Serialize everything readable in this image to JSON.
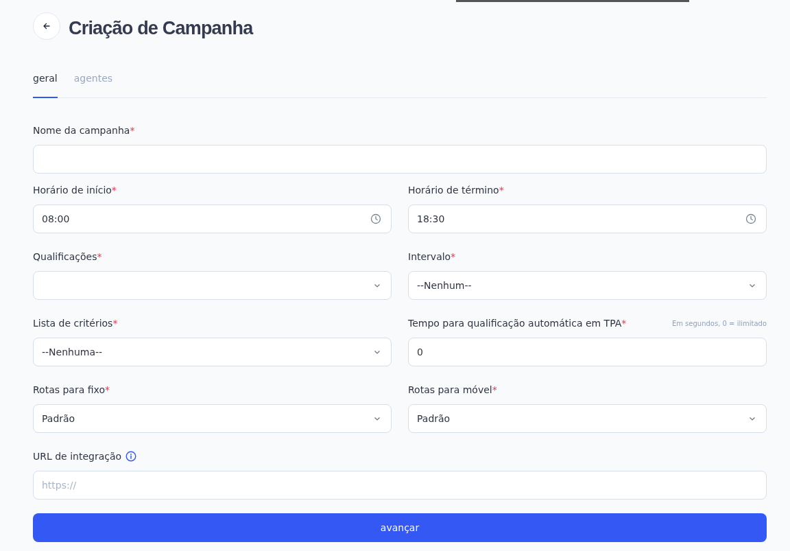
{
  "title": "Criação de Campanha",
  "tabs": [
    {
      "label": "geral",
      "selected": true
    },
    {
      "label": "agentes",
      "selected": false
    }
  ],
  "rows": [
    {
      "fields": [
        {
          "kind": "text",
          "label": "Nome da campanha",
          "required_mark": "*"
        }
      ]
    },
    {
      "fields": [
        {
          "kind": "time",
          "label": "Horário de início",
          "required_mark": "*",
          "value": "08:00"
        },
        {
          "kind": "time",
          "label": "Horário de término",
          "required_mark": "*",
          "value": "18:30"
        }
      ]
    },
    {
      "fields": [
        {
          "kind": "select",
          "label": "Qualificações",
          "required_mark": "*"
        },
        {
          "kind": "select",
          "label": "Intervalo",
          "required_mark": "*",
          "value": "--Nenhum--"
        }
      ]
    },
    {
      "fields": [
        {
          "kind": "select",
          "label": "Lista de critérios",
          "required_mark": "*",
          "value": "--Nenhuma--"
        },
        {
          "kind": "text",
          "label": "Tempo para qualificação automática em TPA",
          "required_mark": "*",
          "hint": "Em segundos, 0 = ilimitado",
          "value": "0"
        }
      ]
    },
    {
      "fields": [
        {
          "kind": "select",
          "label": "Rotas para fixo",
          "required_mark": "*",
          "value": "Padrão"
        },
        {
          "kind": "select",
          "label": "Rotas para móvel",
          "required_mark": "*",
          "value": "Padrão"
        }
      ]
    },
    {
      "fields": [
        {
          "kind": "text",
          "label": "URL de integração",
          "info": true,
          "placeholder": "https://"
        }
      ]
    }
  ],
  "submit": "avançar"
}
